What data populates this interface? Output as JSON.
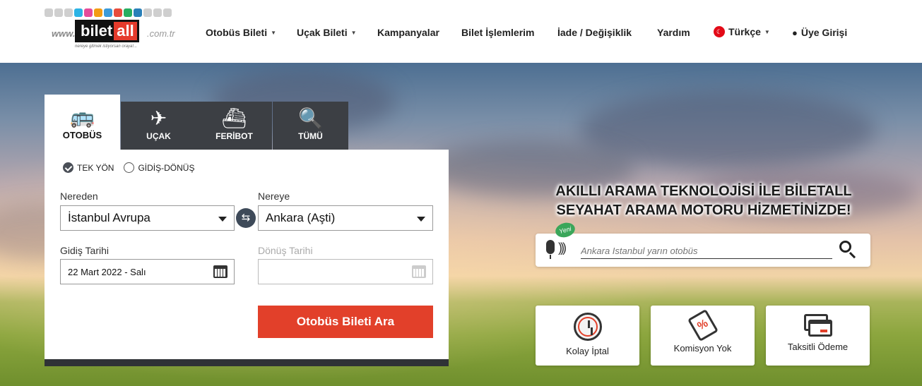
{
  "logo": {
    "www": "www.",
    "bilet": "bilet",
    "all": "all",
    "domain": ".com.tr",
    "slogan": "nereye gitmek istiyorsan oraya!..."
  },
  "nav": {
    "items": [
      {
        "label": "Otobüs Bileti",
        "dropdown": true
      },
      {
        "label": "Uçak Bileti",
        "dropdown": true
      },
      {
        "label": "Kampanyalar",
        "dropdown": false
      },
      {
        "label": "Bilet İşlemlerim",
        "dropdown": false
      },
      {
        "label": "İade / Değişiklik",
        "dropdown": false
      },
      {
        "label": "Yardım",
        "dropdown": false
      }
    ],
    "language": "Türkçe",
    "login": "Üye Girişi"
  },
  "tabs": [
    {
      "label": "OTOBÜS",
      "icon": "bus-icon",
      "active": true
    },
    {
      "label": "UÇAK",
      "icon": "plane-icon",
      "active": false
    },
    {
      "label": "FERİBOT",
      "icon": "ship-icon",
      "active": false
    },
    {
      "label": "TÜMÜ",
      "icon": "search-globe-icon",
      "active": false
    }
  ],
  "trip_type": {
    "one_way": "TEK YÖN",
    "round_trip": "GİDİŞ-DÖNÜŞ",
    "selected": "one_way"
  },
  "form": {
    "from_label": "Nereden",
    "from_value": "İstanbul Avrupa",
    "to_label": "Nereye",
    "to_value": "Ankara (Aşti)",
    "depart_label": "Gidiş Tarihi",
    "depart_value": "22 Mart 2022 - Salı",
    "return_label": "Dönüş Tarihi",
    "return_value": "",
    "search_button": "Otobüs Bileti Ara"
  },
  "promo": {
    "headline_line1": "AKILLI ARAMA TEKNOLOJİSİ İLE BİLETALL",
    "headline_line2": "SEYAHAT ARAMA MOTORU HİZMETİNİZDE!",
    "new_badge": "Yeni",
    "voice_placeholder": "Ankara Istanbul yarın otobüs"
  },
  "features": [
    {
      "label": "Kolay İptal",
      "icon": "clock-icon"
    },
    {
      "label": "Komisyon Yok",
      "icon": "ticket-percent-icon"
    },
    {
      "label": "Taksitli Ödeme",
      "icon": "credit-cards-icon"
    }
  ],
  "colors": {
    "accent": "#e2402a",
    "tab_dark": "#3c3f44"
  }
}
